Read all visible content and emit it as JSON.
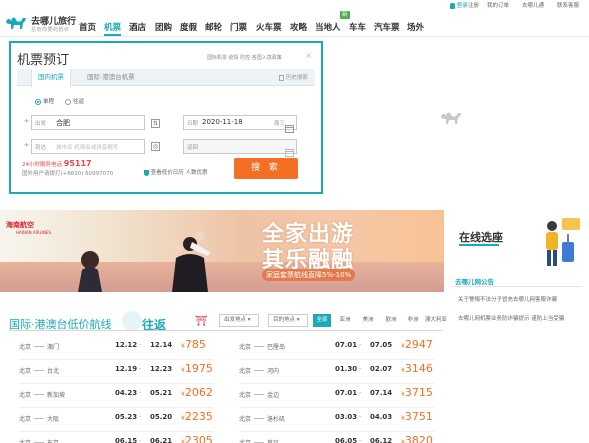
{
  "header": {
    "logo_text": "去哪儿旅行",
    "logo_sub": "总有你要的低价",
    "nav": [
      {
        "label": "首页"
      },
      {
        "label": "机票"
      },
      {
        "label": "酒店"
      },
      {
        "label": "团购"
      },
      {
        "label": "度假"
      },
      {
        "label": "邮轮"
      },
      {
        "label": "门票"
      },
      {
        "label": "火车票"
      },
      {
        "label": "攻略"
      },
      {
        "label": "当地人"
      },
      {
        "label": "车车"
      },
      {
        "label": "汽车票"
      },
      {
        "label": "场外"
      }
    ],
    "nav_badge": "新",
    "utility": [
      "登录",
      "注册",
      "我的订单",
      "去哪儿通",
      "联系客服"
    ]
  },
  "booking": {
    "title": "机票预订",
    "notice": "国际机票 疫情 防控 各国入境政策",
    "tabs": [
      "国内机票",
      "国际·港澳台机票"
    ],
    "history": "历史搜索",
    "trip_types": [
      "单程",
      "往返"
    ],
    "from_label": "出发",
    "from_value": "合肥",
    "to_label": "到达",
    "to_placeholder": "城市名·机场名或拼音缩写",
    "date_label": "日期",
    "date_value": "2020-11-18",
    "date_weekday": "周三",
    "return_label": "返回",
    "hotline_label": "24小时服务电话",
    "hotline_number": "95117",
    "hotline_sub": "国外用户请拨打(+8610) 60997070",
    "check_label": "查看低价日历 人数优惠",
    "search_button": "搜 索"
  },
  "banner": {
    "airline": "海南航空",
    "airline_en": "HAINAN AIRLINES",
    "headline_1": "全家出游",
    "headline_2": "其乐融融",
    "tag": "家庭套票航线直降5%-10%"
  },
  "side": {
    "online_title": "在线选座",
    "bulletin_title": "去哪儿网公告",
    "bulletins": [
      "关于警惕不法分子冒充去哪儿网客服诈骗",
      "去哪儿网机票业务防诈骗提示 谨防上当受骗"
    ]
  },
  "routes": {
    "title": "国际·港澳台低价航线",
    "round_trip": "往返",
    "from_select": "出发地点",
    "to_select": "目的地点",
    "tabs": [
      "全部",
      "亚洲",
      "美洲",
      "欧洲",
      "非洲",
      "澳大利亚"
    ],
    "left": [
      {
        "from": "北京",
        "to": "澳门",
        "d1": "12.12",
        "d2": "12.14",
        "price": "785"
      },
      {
        "from": "北京",
        "to": "台北",
        "d1": "12.19",
        "d2": "12.23",
        "price": "1975"
      },
      {
        "from": "北京",
        "to": "新加坡",
        "d1": "04.23",
        "d2": "05.21",
        "price": "2062"
      },
      {
        "from": "北京",
        "to": "大阪",
        "d1": "05.23",
        "d2": "05.20",
        "price": "2235"
      },
      {
        "from": "北京",
        "to": "东京",
        "d1": "06.15",
        "d2": "06.21",
        "price": "2305"
      }
    ],
    "right": [
      {
        "from": "北京",
        "to": "巴厘岛",
        "d1": "07.01",
        "d2": "07.05",
        "price": "2947"
      },
      {
        "from": "北京",
        "to": "河内",
        "d1": "01.30",
        "d2": "02.07",
        "price": "3146"
      },
      {
        "from": "北京",
        "to": "金边",
        "d1": "07.01",
        "d2": "07.14",
        "price": "3715"
      },
      {
        "from": "北京",
        "to": "洛杉矶",
        "d1": "03.03",
        "d2": "04.03",
        "price": "3751"
      },
      {
        "from": "北京",
        "to": "首尔",
        "d1": "06.05",
        "d2": "06.12",
        "price": "3820"
      }
    ],
    "currency": "¥"
  },
  "colors": {
    "accent": "#1ba9ba",
    "price": "#f36f23",
    "search_button": "#f36f23",
    "hotline": "#e84848"
  }
}
